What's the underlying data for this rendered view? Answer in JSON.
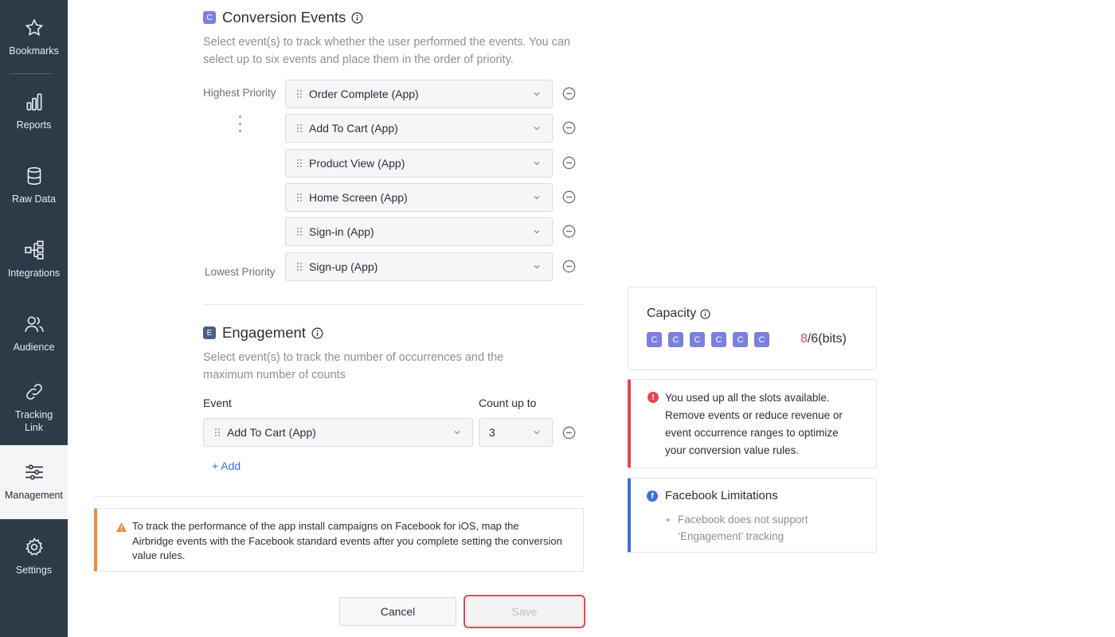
{
  "sidebar": {
    "items": [
      {
        "label": "Bookmarks",
        "icon": "star-icon"
      },
      {
        "label": "Reports",
        "icon": "bar-chart-icon"
      },
      {
        "label": "Raw Data",
        "icon": "database-icon"
      },
      {
        "label": "Integrations",
        "icon": "integrations-icon"
      },
      {
        "label": "Audience",
        "icon": "audience-icon"
      },
      {
        "label": "Tracking Link",
        "icon": "link-icon"
      },
      {
        "label": "Management",
        "icon": "sliders-icon",
        "active": true
      },
      {
        "label": "Settings",
        "icon": "gear-icon"
      }
    ]
  },
  "conversion": {
    "badge": "C",
    "title": "Conversion Events",
    "description": "Select event(s) to track whether the user performed the events. You can select up to six events and place them in the order of priority.",
    "highest_label": "Highest Priority",
    "lowest_label": "Lowest Priority",
    "events": [
      "Order Complete (App)",
      "Add To Cart (App)",
      "Product View (App)",
      "Home Screen (App)",
      "Sign-in (App)",
      "Sign-up (App)"
    ]
  },
  "engagement": {
    "badge": "E",
    "title": "Engagement",
    "description": "Select event(s) to track the number of occurrences and the maximum number of counts",
    "event_col": "Event",
    "count_col": "Count up to",
    "event_value": "Add To Cart (App)",
    "count_value": "3",
    "add_label": "+ Add"
  },
  "warning": {
    "text": "To track the performance of the app install campaigns on Facebook for iOS, map the Airbridge events with the Facebook standard events after you complete setting the conversion value rules."
  },
  "buttons": {
    "cancel": "Cancel",
    "save": "Save"
  },
  "capacity": {
    "title": "Capacity",
    "chips": [
      "C",
      "C",
      "C",
      "C",
      "C",
      "C"
    ],
    "used": "8",
    "total": "/6(bits)"
  },
  "error_card": {
    "text": "You used up all the slots available. Remove events or reduce revenue or event occurrence ranges to optimize your conversion value rules."
  },
  "facebook_card": {
    "title": "Facebook Limitations",
    "item": "Facebook does not support ‘Engagement’ tracking"
  },
  "colors": {
    "sidebar_bg": "#2d3a47",
    "accent_purple": "#7b7fe0",
    "error_red": "#e0484f",
    "warning_orange": "#f08a3a",
    "link_blue": "#3f6fd8"
  }
}
